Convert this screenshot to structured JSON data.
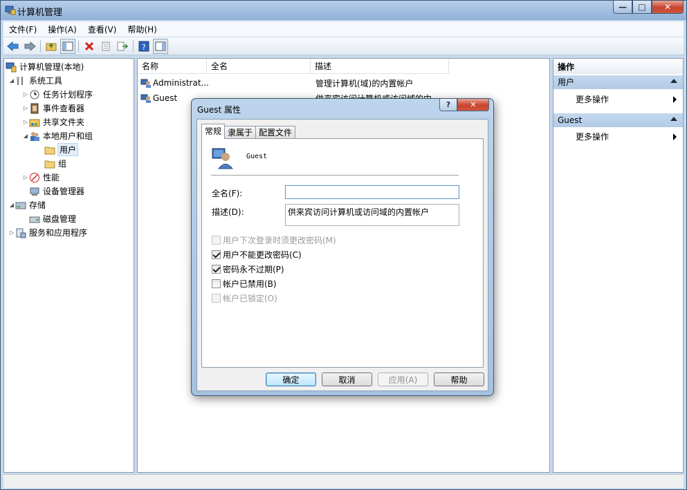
{
  "window": {
    "title": "计算机管理",
    "min": "—",
    "max": "□",
    "close": "✕"
  },
  "menu": [
    "文件(F)",
    "操作(A)",
    "查看(V)",
    "帮助(H)"
  ],
  "tree": {
    "root": "计算机管理(本地)",
    "system_tools": "系统工具",
    "task_scheduler": "任务计划程序",
    "event_viewer": "事件查看器",
    "shared_folders": "共享文件夹",
    "local_users_groups": "本地用户和组",
    "users": "用户",
    "groups": "组",
    "performance": "性能",
    "device_manager": "设备管理器",
    "storage": "存储",
    "disk_management": "磁盘管理",
    "services_apps": "服务和应用程序"
  },
  "list": {
    "columns": [
      "名称",
      "全名",
      "描述"
    ],
    "rows": [
      {
        "name": "Administrat...",
        "full_name": "",
        "description": "管理计算机(域)的内置帐户"
      },
      {
        "name": "Guest",
        "full_name": "",
        "description": "供来宾访问计算机或访问域的内..."
      }
    ]
  },
  "actions": {
    "header": "操作",
    "section1": "用户",
    "section1_more": "更多操作",
    "section2": "Guest",
    "section2_more": "更多操作"
  },
  "dialog": {
    "title": "Guest 属性",
    "help": "?",
    "close": "✕",
    "tabs": [
      "常规",
      "隶属于",
      "配置文件"
    ],
    "username": "Guest",
    "full_name_label": "全名(F):",
    "full_name_value": "",
    "description_label": "描述(D):",
    "description_value": "供来宾访问计算机或访问域的内置帐户",
    "checkboxes": [
      {
        "label": "用户下次登录时须更改密码(M)",
        "checked": false,
        "enabled": false
      },
      {
        "label": "用户不能更改密码(C)",
        "checked": true,
        "enabled": true
      },
      {
        "label": "密码永不过期(P)",
        "checked": true,
        "enabled": true
      },
      {
        "label": "帐户已禁用(B)",
        "checked": false,
        "enabled": true
      },
      {
        "label": "帐户已锁定(O)",
        "checked": false,
        "enabled": false
      }
    ],
    "buttons": {
      "ok": "确定",
      "cancel": "取消",
      "apply": "应用(A)",
      "help": "帮助"
    }
  }
}
